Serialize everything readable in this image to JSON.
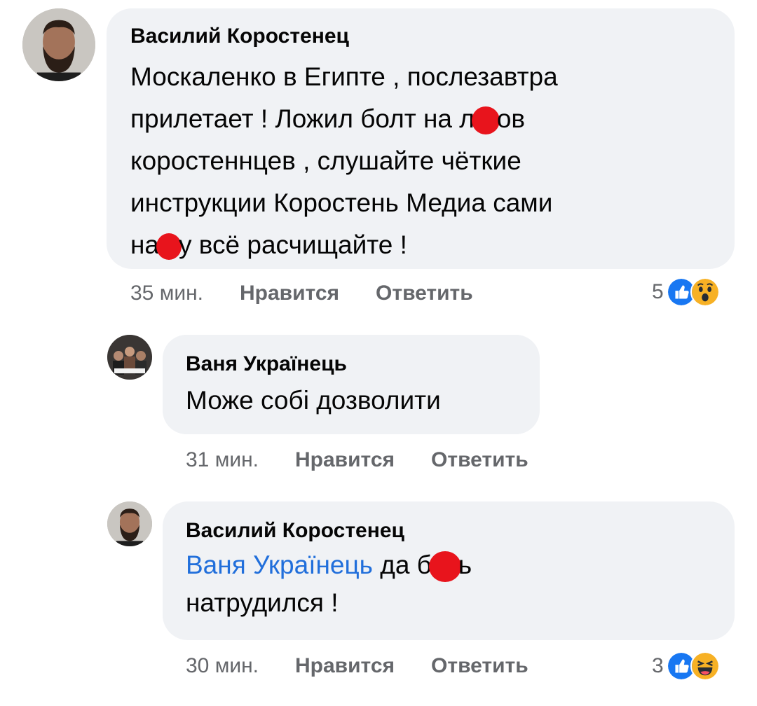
{
  "comments": [
    {
      "author": "Василий Коростенец",
      "lines": [
        {
          "a": "Москаленко в Египте , послезавтра"
        },
        {
          "a": "прилетает  ! Ложил болт на л",
          "b": "ов"
        },
        {
          "a": "коростеннцев , слушайте чёткие"
        },
        {
          "a": "инструкции Коростень Медиа сами"
        },
        {
          "a": "на",
          "b": "у всё расчищайте !"
        }
      ],
      "time": "35 мин.",
      "like": "Нравится",
      "reply": "Ответить",
      "reaction_count": "5",
      "reactions": [
        "like-icon",
        "wow-icon"
      ]
    },
    {
      "author": "Ваня Українець",
      "lines": [
        {
          "a": "Може собі дозволити"
        }
      ],
      "time": "31 мин.",
      "like": "Нравится",
      "reply": "Ответить"
    },
    {
      "author": "Василий Коростенец",
      "mention": "Ваня Українець",
      "lines": [
        {
          "a": " да б",
          "b": "ь"
        },
        {
          "a": "натрудился !"
        }
      ],
      "time": "30 мин.",
      "like": "Нравится",
      "reply": "Ответить",
      "reaction_count": "3",
      "reactions": [
        "like-icon",
        "haha-icon"
      ]
    }
  ],
  "colors": {
    "bubble": "#f0f2f5",
    "meta": "#65676b",
    "mention": "#216fdb",
    "redaction": "#e8141c",
    "like": "#1877f2"
  }
}
